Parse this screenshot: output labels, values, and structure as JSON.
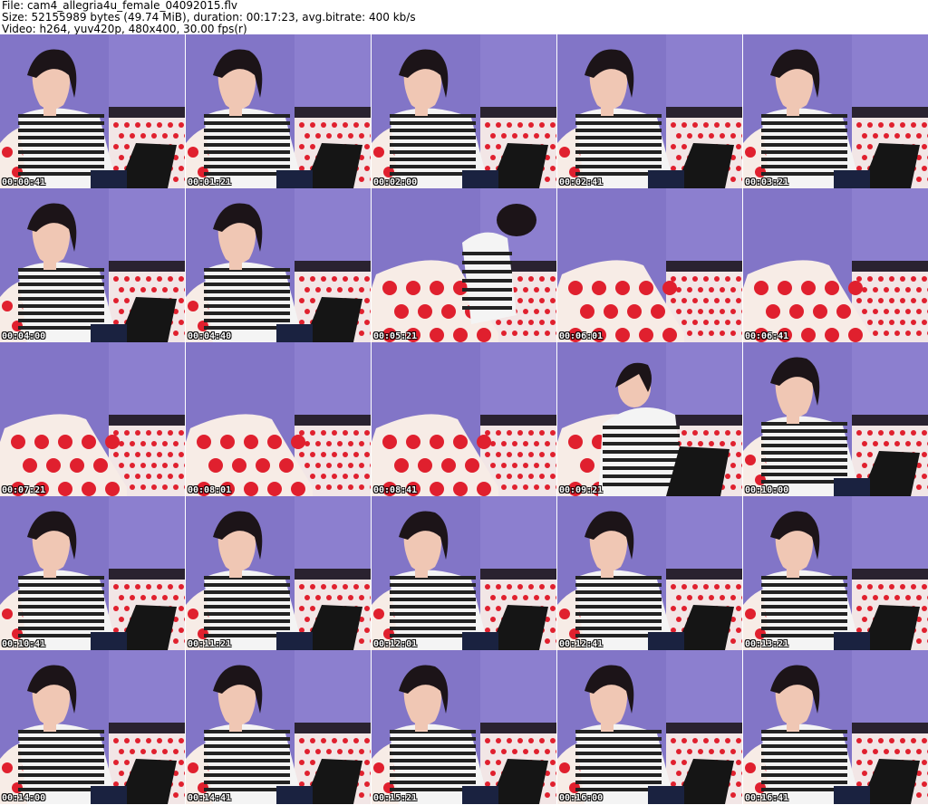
{
  "header": {
    "file_line": "File: cam4_allegria4u_female_04092015.flv",
    "size_line": "Size: 52155989 bytes (49.74 MiB), duration: 00:17:23, avg.bitrate: 400 kb/s",
    "video_line": "Video: h264, yuv420p, 480x400, 30.00 fps(r)"
  },
  "thumbnails": [
    {
      "time": "00:00:41",
      "scene": "person"
    },
    {
      "time": "00:01:21",
      "scene": "person"
    },
    {
      "time": "00:02:00",
      "scene": "person"
    },
    {
      "time": "00:02:41",
      "scene": "person"
    },
    {
      "time": "00:03:21",
      "scene": "person"
    },
    {
      "time": "00:04:00",
      "scene": "person"
    },
    {
      "time": "00:04:40",
      "scene": "person"
    },
    {
      "time": "00:05:21",
      "scene": "moving"
    },
    {
      "time": "00:06:01",
      "scene": "empty"
    },
    {
      "time": "00:06:41",
      "scene": "empty"
    },
    {
      "time": "00:07:21",
      "scene": "empty"
    },
    {
      "time": "00:08:01",
      "scene": "empty"
    },
    {
      "time": "00:08:41",
      "scene": "empty"
    },
    {
      "time": "00:09:21",
      "scene": "typing"
    },
    {
      "time": "00:10:00",
      "scene": "person"
    },
    {
      "time": "00:10:41",
      "scene": "person"
    },
    {
      "time": "00:11:21",
      "scene": "person"
    },
    {
      "time": "00:12:01",
      "scene": "person"
    },
    {
      "time": "00:12:41",
      "scene": "person"
    },
    {
      "time": "00:13:21",
      "scene": "person"
    },
    {
      "time": "00:14:00",
      "scene": "person"
    },
    {
      "time": "00:14:41",
      "scene": "person"
    },
    {
      "time": "00:15:21",
      "scene": "person"
    },
    {
      "time": "00:16:00",
      "scene": "person"
    },
    {
      "time": "00:16:41",
      "scene": "person"
    }
  ],
  "colors": {
    "wall": "#8c7fcf",
    "wall_dark": "#6f63b8",
    "pillow": "#f7ece6",
    "dot": "#e0202e",
    "sheet": "#f2e6e6",
    "stripe": "#222222",
    "skin": "#f0c7b4",
    "hair": "#1c1418",
    "keyboard": "#151515"
  }
}
